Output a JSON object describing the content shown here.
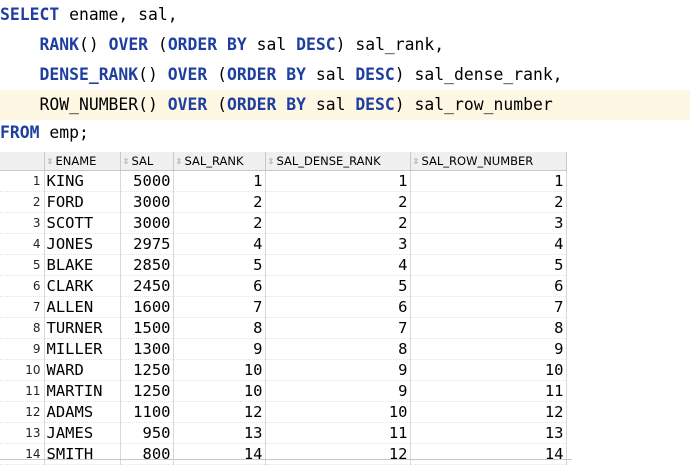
{
  "editor": {
    "line1": {
      "kw_select": "SELECT",
      "rest": " ename, sal,"
    },
    "line2": {
      "indent": "    ",
      "fn": "RANK",
      "paren": "() ",
      "kw_over": "OVER",
      "open": " (",
      "kw_order": "ORDER BY",
      "col": " sal ",
      "kw_desc": "DESC",
      "close": ") sal_rank,"
    },
    "line3": {
      "indent": "    ",
      "fn": "DENSE_RANK",
      "paren": "() ",
      "kw_over": "OVER",
      "open": " (",
      "kw_order": "ORDER BY",
      "col": " sal ",
      "kw_desc": "DESC",
      "close": ") sal_dense_rank,"
    },
    "line4": {
      "indent": "    ",
      "fn": "ROW_NUMBER",
      "paren": "() ",
      "kw_over": "OVER",
      "open": " (",
      "kw_order": "ORDER BY",
      "col": " sal ",
      "kw_desc": "DESC",
      "close": ") sal_row_number"
    },
    "line5": {
      "kw_from": "FROM",
      "rest": " emp;"
    }
  },
  "grid": {
    "columns": [
      "ENAME",
      "SAL",
      "SAL_RANK",
      "SAL_DENSE_RANK",
      "SAL_ROW_NUMBER"
    ],
    "rows": [
      {
        "n": "1",
        "ename": "KING",
        "sal": "5000",
        "rank": "1",
        "dense": "1",
        "rownum": "1"
      },
      {
        "n": "2",
        "ename": "FORD",
        "sal": "3000",
        "rank": "2",
        "dense": "2",
        "rownum": "2"
      },
      {
        "n": "3",
        "ename": "SCOTT",
        "sal": "3000",
        "rank": "2",
        "dense": "2",
        "rownum": "3"
      },
      {
        "n": "4",
        "ename": "JONES",
        "sal": "2975",
        "rank": "4",
        "dense": "3",
        "rownum": "4"
      },
      {
        "n": "5",
        "ename": "BLAKE",
        "sal": "2850",
        "rank": "5",
        "dense": "4",
        "rownum": "5"
      },
      {
        "n": "6",
        "ename": "CLARK",
        "sal": "2450",
        "rank": "6",
        "dense": "5",
        "rownum": "6"
      },
      {
        "n": "7",
        "ename": "ALLEN",
        "sal": "1600",
        "rank": "7",
        "dense": "6",
        "rownum": "7"
      },
      {
        "n": "8",
        "ename": "TURNER",
        "sal": "1500",
        "rank": "8",
        "dense": "7",
        "rownum": "8"
      },
      {
        "n": "9",
        "ename": "MILLER",
        "sal": "1300",
        "rank": "9",
        "dense": "8",
        "rownum": "9"
      },
      {
        "n": "10",
        "ename": "WARD",
        "sal": "1250",
        "rank": "10",
        "dense": "9",
        "rownum": "10"
      },
      {
        "n": "11",
        "ename": "MARTIN",
        "sal": "1250",
        "rank": "10",
        "dense": "9",
        "rownum": "11"
      },
      {
        "n": "12",
        "ename": "ADAMS",
        "sal": "1100",
        "rank": "12",
        "dense": "10",
        "rownum": "12"
      },
      {
        "n": "13",
        "ename": "JAMES",
        "sal": "950",
        "rank": "13",
        "dense": "11",
        "rownum": "13"
      },
      {
        "n": "14",
        "ename": "SMITH",
        "sal": "800",
        "rank": "14",
        "dense": "12",
        "rownum": "14"
      }
    ]
  },
  "colors": {
    "keyword": "#1f3fa0",
    "current_line": "#fdf7e3",
    "header_bg": "#f0f0f0"
  },
  "icons": {
    "sort": "sort-arrows-icon"
  }
}
